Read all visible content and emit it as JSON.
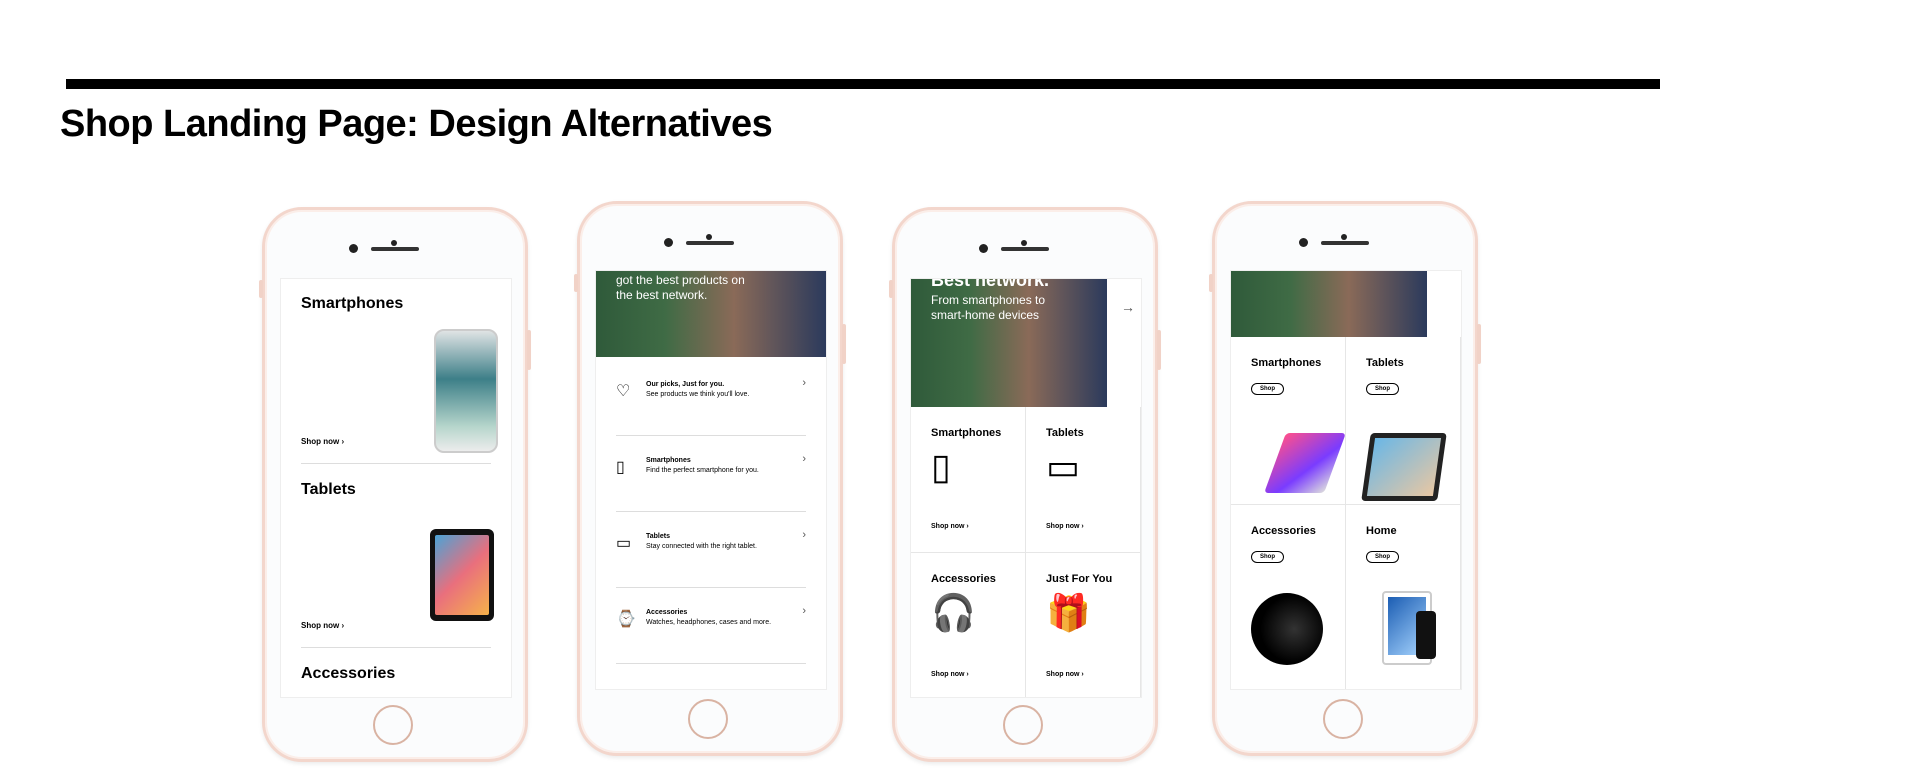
{
  "page": {
    "title": "Shop Landing Page: Design Alternatives"
  },
  "phone1": {
    "sections": [
      {
        "heading": "Smartphones",
        "shop": "Shop now ›"
      },
      {
        "heading": "Tablets",
        "shop": "Shop now ›"
      },
      {
        "heading": "Accessories"
      }
    ]
  },
  "phone2": {
    "hero_text": "got the best products on the best network.",
    "rows": [
      {
        "icon": "heart-icon",
        "glyph": "♡",
        "title": "Our picks, Just for you.",
        "desc": "See products we think you'll love."
      },
      {
        "icon": "smartphone-icon",
        "glyph": "▯",
        "title": "Smartphones",
        "desc": "Find the perfect smartphone for you."
      },
      {
        "icon": "tablet-icon",
        "glyph": "▭",
        "title": "Tablets",
        "desc": "Stay connected with the right tablet."
      },
      {
        "icon": "watch-icon",
        "glyph": "⌚",
        "title": "Accessories",
        "desc": "Watches, headphones, cases and more."
      }
    ]
  },
  "phone3": {
    "hero_title": "Best network.",
    "hero_sub": "From smartphones to smart-home devices",
    "cells": [
      {
        "heading": "Smartphones",
        "icon": "smartphone-icon",
        "glyph": "▯",
        "shop": "Shop now ›"
      },
      {
        "heading": "Tablets",
        "icon": "tablet-icon",
        "glyph": "▭",
        "shop": "Shop now ›"
      },
      {
        "heading": "Accessories",
        "icon": "headphones-icon",
        "glyph": "🎧",
        "shop": "Shop now ›"
      },
      {
        "heading": "Just For You",
        "icon": "gift-icon",
        "glyph": "🎁",
        "shop": "Shop now ›"
      }
    ]
  },
  "phone4": {
    "cells": [
      {
        "heading": "Smartphones",
        "shop": "Shop"
      },
      {
        "heading": "Tablets",
        "shop": "Shop"
      },
      {
        "heading": "Accessories",
        "shop": "Shop"
      },
      {
        "heading": "Home",
        "shop": "Shop"
      }
    ]
  },
  "colors": {
    "accent": "#000000",
    "phone_frame": "#f3d6cc"
  }
}
